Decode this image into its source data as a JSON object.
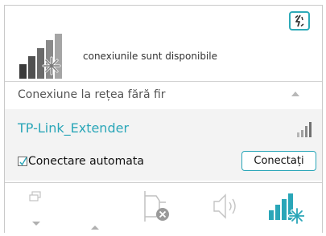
{
  "status": {
    "text": "conexiunile sunt disponibile",
    "icon": "network-available-icon"
  },
  "header": {
    "refresh_icon": "refresh-icon"
  },
  "section": {
    "title": "Conexiune la rețea fără fir",
    "arrow_icon": "collapse-arrow-icon"
  },
  "network": {
    "ssid": "TP-Link_Extender",
    "signal_icon": "signal-strength-icon",
    "auto_connect_label": "Conectare automata",
    "auto_connect_checked": true,
    "connect_label": "Conectați"
  },
  "taskbar": {
    "icons": [
      "windows-icon",
      "show-hidden-icons",
      "power-disconnected-icon",
      "volume-icon",
      "network-icon"
    ]
  },
  "colors": {
    "accent": "#2aa6b8",
    "item_background": "#f3f3f3",
    "text": "#111111"
  }
}
